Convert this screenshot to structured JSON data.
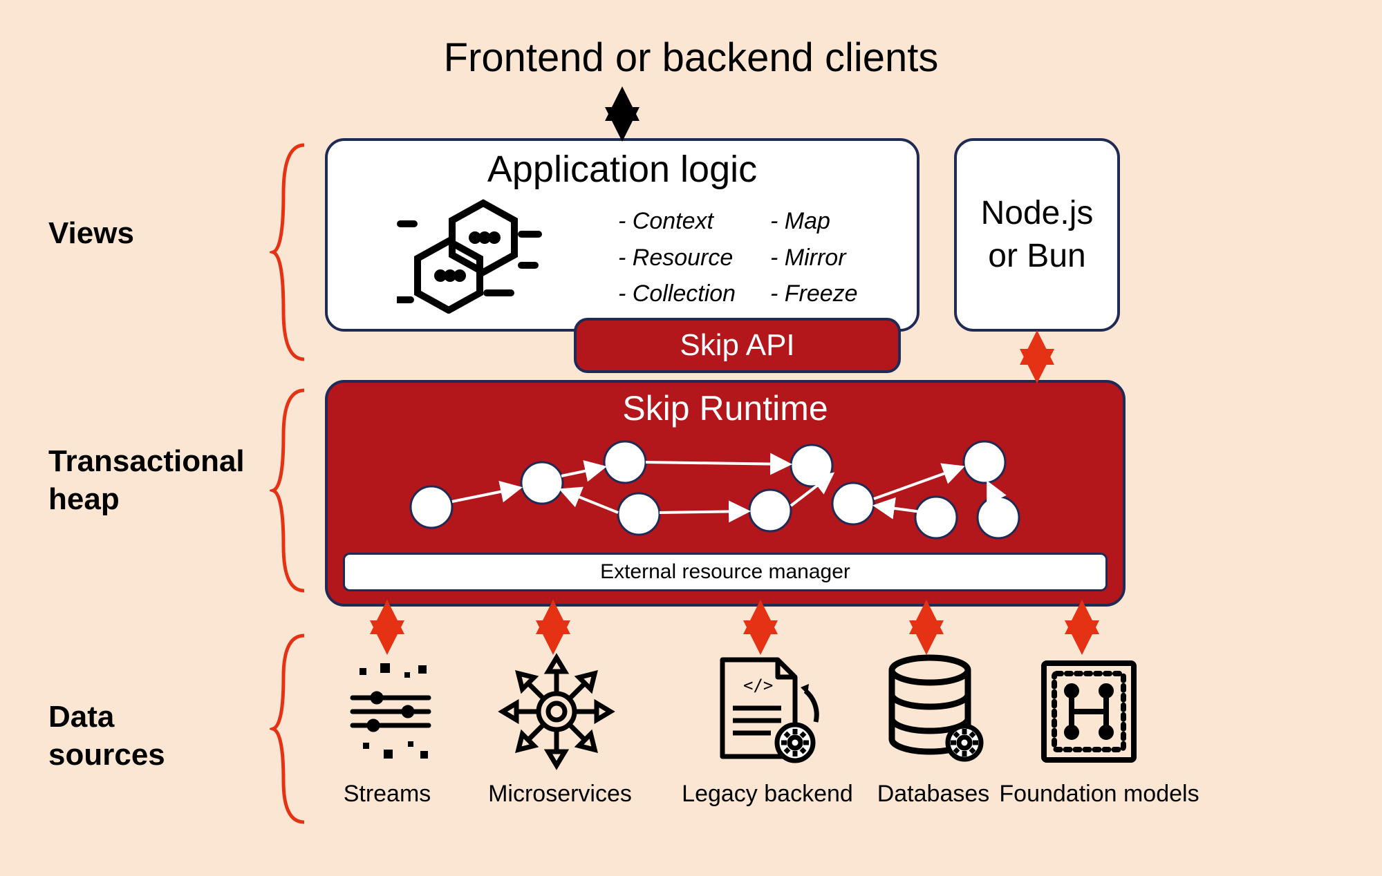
{
  "title": "Frontend or backend clients",
  "rows": {
    "views": "Views",
    "heap": "Transactional\nheap",
    "sources": "Data\nsources"
  },
  "app": {
    "title": "Application logic",
    "apis_col1": [
      "- Context",
      "- Resource",
      "- Collection"
    ],
    "apis_col2": [
      "- Map",
      "- Mirror",
      "- Freeze"
    ]
  },
  "runtime_host": "Node.js\nor Bun",
  "skip_api": "Skip API",
  "runtime": {
    "title": "Skip Runtime",
    "ext_mgr": "External resource manager"
  },
  "data_sources": [
    {
      "key": "streams",
      "label": "Streams"
    },
    {
      "key": "microservices",
      "label": "Microservices"
    },
    {
      "key": "legacy",
      "label": "Legacy backend"
    },
    {
      "key": "databases",
      "label": "Databases"
    },
    {
      "key": "foundation",
      "label": "Foundation models"
    }
  ]
}
